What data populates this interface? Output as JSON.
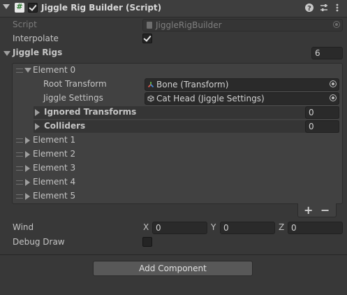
{
  "header": {
    "title": "Jiggle Rig Builder (Script)",
    "enabled": true,
    "help_icon": "question-circle-icon",
    "presets_icon": "sliders-icon",
    "menu_icon": "vertical-dots-icon"
  },
  "script_field": {
    "label": "Script",
    "value": "JiggleRigBuilder"
  },
  "interpolate": {
    "label": "Interpolate",
    "checked": true
  },
  "jiggle_rigs": {
    "label": "Jiggle Rigs",
    "size": "6",
    "element0": {
      "label": "Element 0",
      "root_transform": {
        "label": "Root Transform",
        "value": "Bone (Transform)"
      },
      "jiggle_settings": {
        "label": "Jiggle Settings",
        "value": "Cat Head (Jiggle Settings)"
      },
      "ignored_transforms": {
        "label": "Ignored Transforms",
        "size": "0"
      },
      "colliders": {
        "label": "Colliders",
        "size": "0"
      }
    },
    "collapsed_elements": [
      "Element 1",
      "Element 2",
      "Element 3",
      "Element 4",
      "Element 5"
    ],
    "add_label": "+",
    "remove_label": "−"
  },
  "wind": {
    "label": "Wind",
    "x_label": "X",
    "x": "0",
    "y_label": "Y",
    "y": "0",
    "z_label": "Z",
    "z": "0"
  },
  "debug_draw": {
    "label": "Debug Draw",
    "checked": false
  },
  "add_component": {
    "label": "Add Component"
  },
  "colors": {
    "background": "#383838",
    "field": "#2a2a2a",
    "button": "#585858",
    "text": "#c4c4c4"
  }
}
